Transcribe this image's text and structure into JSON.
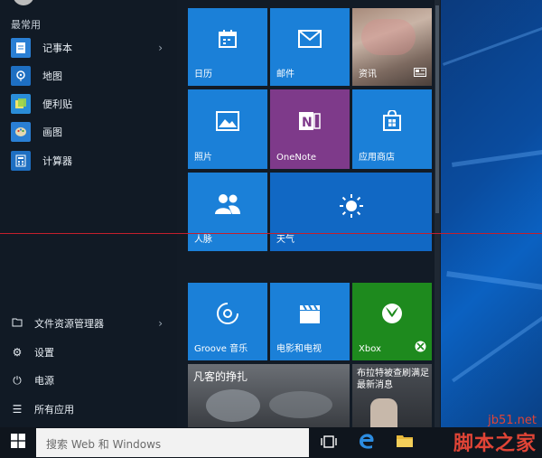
{
  "start_menu": {
    "most_used_label": "最常用",
    "apps": [
      {
        "label": "记事本",
        "icon": "notepad-icon",
        "color": "#2a7fd4",
        "has_arrow": true
      },
      {
        "label": "地图",
        "icon": "maps-icon",
        "color": "#1e6fc2",
        "has_arrow": false
      },
      {
        "label": "便利贴",
        "icon": "sticky-notes-icon",
        "color": "#2a8dd8",
        "has_arrow": false
      },
      {
        "label": "画图",
        "icon": "paint-icon",
        "color": "#2a7fd4",
        "has_arrow": false
      },
      {
        "label": "计算器",
        "icon": "calculator-icon",
        "color": "#1e6fc2",
        "has_arrow": false
      }
    ],
    "system_items": [
      {
        "label": "文件资源管理器",
        "icon": "file-explorer-icon",
        "has_arrow": true
      },
      {
        "label": "设置",
        "icon": "gear-icon",
        "has_arrow": false
      },
      {
        "label": "电源",
        "icon": "power-icon",
        "has_arrow": false
      },
      {
        "label": "所有应用",
        "icon": "all-apps-icon",
        "has_arrow": false
      }
    ]
  },
  "tiles": {
    "calendar": "日历",
    "mail": "邮件",
    "news": "资讯",
    "photos": "照片",
    "onenote": "OneNote",
    "store": "应用商店",
    "people": "人脉",
    "weather": "天气",
    "groove": "Groove 音乐",
    "movies": "电影和电视",
    "xbox": "Xbox",
    "money_headline": "凡客的挣扎",
    "sports_headline": "布拉特被查刷满足最新消息"
  },
  "taskbar": {
    "search_placeholder": "搜索 Web 和 Windows"
  },
  "watermark": {
    "site": "jb51.net",
    "name": "脚本之家"
  },
  "colors": {
    "tile_blue": "#1b80d8",
    "onenote_purple": "#7e3a8a",
    "xbox_green": "#1e8a1e",
    "redline": "#c31f2d"
  }
}
